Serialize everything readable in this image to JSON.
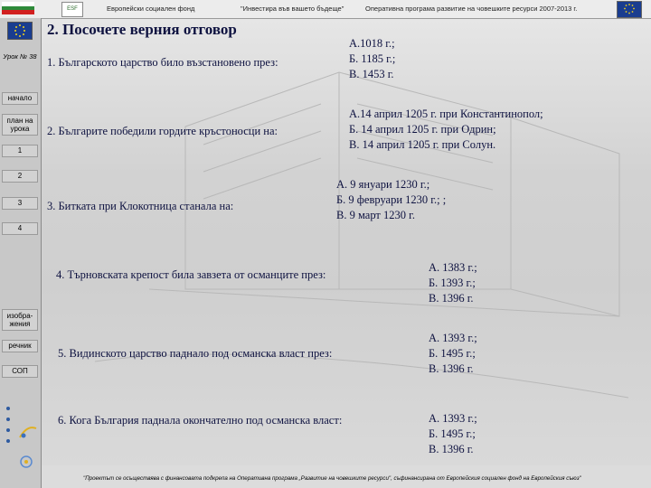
{
  "header": {
    "fund": "Европейски социален фонд",
    "slogan": "\"Инвестира във вашето бъдеще\"",
    "program": "Оперативна програма развитие на човешките ресурси 2007-2013 г."
  },
  "nav": {
    "lesson": "Урок № 38",
    "start": "начало",
    "plan": "план на урока",
    "items": [
      "1",
      "2",
      "3",
      "4"
    ],
    "images": "изобра-жения",
    "dictionary": "речник",
    "sop": "СОП"
  },
  "title": "2. Посочете верния отговор",
  "questions": [
    {
      "text": "1. Българското царство било възстановено през:",
      "answers": [
        "А.1018 г.;",
        "Б. 1185 г.;",
        "В. 1453 г."
      ]
    },
    {
      "text": "2. Българите победили гордите кръстоносци на:",
      "answers": [
        "А.14 април 1205 г. при Константинопол;",
        "Б. 14 април 1205 г. при Одрин;",
        "В. 14 април 1205 г. при Солун."
      ]
    },
    {
      "text": "3. Битката при Клокотница станала на:",
      "answers": [
        "А. 9 януари 1230 г.;",
        "Б. 9 февруари 1230 г.; ;",
        "В. 9 март 1230 г."
      ]
    },
    {
      "text": "4. Търновската крепост била завзета от османците през:",
      "answers": [
        "А. 1383 г.;",
        "Б. 1393 г.;",
        "В. 1396 г."
      ]
    },
    {
      "text": "5. Видинското царство паднало под османска власт през:",
      "answers": [
        "А. 1393 г.;",
        "Б. 1495 г.;",
        "В. 1396 г."
      ]
    },
    {
      "text": "6. Кога България паднала окончателно под османска власт:",
      "answers": [
        "А. 1393 г.;",
        "Б. 1495 г.;",
        "В. 1396 г."
      ]
    }
  ],
  "footer": "\"Проектът се осъществява с финансовата подкрепа на Оперативна програма „Развитие на човешките ресурси\", съфинансирана от Европейския социален фонд на Европейския съюз\"",
  "colors": {
    "text": "#0e1240",
    "flag_white": "#ffffff",
    "flag_green": "#2e8b3a",
    "flag_red": "#d22020",
    "eu_blue": "#1a3d8f"
  }
}
